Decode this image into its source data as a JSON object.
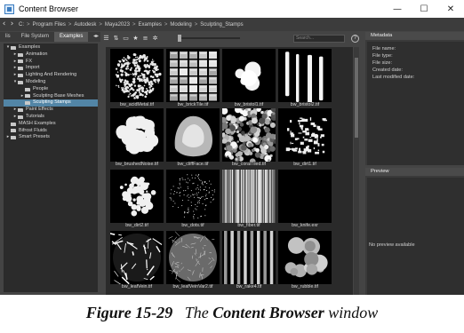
{
  "window": {
    "title": "Content Browser",
    "controls": {
      "minimize": "—",
      "maximize": "☐",
      "close": "✕"
    }
  },
  "path": {
    "back": "‹",
    "forward": "›",
    "crumbs": [
      "C:",
      ">",
      "Program Files",
      ">",
      "Autodesk",
      ">",
      "Maya2023",
      ">",
      "Examples",
      ">",
      "Modeling",
      ">",
      "Sculpting_Stamps"
    ]
  },
  "left_tabs": {
    "first": "lis",
    "second": "File System",
    "third": "Examples",
    "arrows": "◂▸"
  },
  "tree": [
    {
      "label": "Examples",
      "level": 0,
      "expand": "▾",
      "selected": false
    },
    {
      "label": "Animation",
      "level": 1,
      "expand": "▸",
      "selected": false
    },
    {
      "label": "FX",
      "level": 1,
      "expand": "▸",
      "selected": false
    },
    {
      "label": "Import",
      "level": 1,
      "expand": "▸",
      "selected": false
    },
    {
      "label": "Lighting And Rendering",
      "level": 1,
      "expand": "▸",
      "selected": false
    },
    {
      "label": "Modeling",
      "level": 1,
      "expand": "▾",
      "selected": false
    },
    {
      "label": "People",
      "level": 2,
      "expand": "",
      "selected": false
    },
    {
      "label": "Sculpting Base Meshes",
      "level": 2,
      "expand": "▸",
      "selected": false
    },
    {
      "label": "Sculpting Stamps",
      "level": 2,
      "expand": "",
      "selected": true
    },
    {
      "label": "Paint Effects",
      "level": 1,
      "expand": "▸",
      "selected": false
    },
    {
      "label": "Tutorials",
      "level": 1,
      "expand": "▸",
      "selected": false
    },
    {
      "label": "MASH Examples",
      "level": 0,
      "expand": "",
      "selected": false
    },
    {
      "label": "Bifrost Fluids",
      "level": 0,
      "expand": "",
      "selected": false
    },
    {
      "label": "Smart Presets",
      "level": 0,
      "expand": "▸",
      "selected": false
    }
  ],
  "toolbar": {
    "icons": [
      "list-view-icon",
      "sort-icon",
      "new-folder-icon",
      "favorite-icon",
      "filter-icon",
      "settings-icon"
    ],
    "search_placeholder": "Search...",
    "help": "?"
  },
  "thumbnails": [
    {
      "name": "bw_acidMetal.tif",
      "pattern": "acid",
      "selected": false
    },
    {
      "name": "bw_brickTile.tif",
      "pattern": "brick",
      "selected": false
    },
    {
      "name": "bw_bristol1.tif",
      "pattern": "bristol1",
      "selected": false
    },
    {
      "name": "bw_bristol2.tif",
      "pattern": "bristol2",
      "selected": false
    },
    {
      "name": "bw_brushedNoise.tif",
      "pattern": "brushed",
      "selected": false
    },
    {
      "name": "bw_cliffFace.tif",
      "pattern": "cliff",
      "selected": false
    },
    {
      "name": "bw_coralTiled.tif",
      "pattern": "coral",
      "selected": false
    },
    {
      "name": "bw_dirt1.tif",
      "pattern": "dirt1",
      "selected": false
    },
    {
      "name": "bw_dirt2.tif",
      "pattern": "dirt2",
      "selected": false
    },
    {
      "name": "bw_dots.tif",
      "pattern": "dots",
      "selected": false
    },
    {
      "name": "bw_fiber.tif",
      "pattern": "fiber",
      "selected": false
    },
    {
      "name": "bw_knife.exr",
      "pattern": "empty",
      "selected": false
    },
    {
      "name": "bw_leafVein.tif",
      "pattern": "leaf",
      "selected": false
    },
    {
      "name": "bw_leafVeinVar2.tif",
      "pattern": "leaf2",
      "selected": false
    },
    {
      "name": "bw_rake4.tif",
      "pattern": "rake",
      "selected": false
    },
    {
      "name": "bw_rubble.tif",
      "pattern": "rubble",
      "selected": false
    }
  ],
  "metadata": {
    "title": "Metadata",
    "fields": [
      "File name:",
      "File type:",
      "File size:",
      "Created date:",
      "Last modified date:"
    ]
  },
  "preview": {
    "title": "Preview",
    "empty_text": "No preview available"
  },
  "caption": {
    "figure": "Figure 15-29",
    "the": "The",
    "bold": "Content Browser",
    "rest": "window"
  }
}
